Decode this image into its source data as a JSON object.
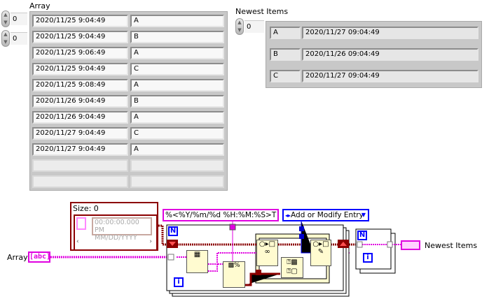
{
  "front_panel": {
    "array": {
      "label": "Array",
      "index_row": "0",
      "index_col": "0",
      "rows": [
        {
          "time": "2020/11/25 9:04:49",
          "name": "A"
        },
        {
          "time": "2020/11/25 9:04:49",
          "name": "B"
        },
        {
          "time": "2020/11/25 9:06:49",
          "name": "A"
        },
        {
          "time": "2020/11/25 9:04:49",
          "name": "C"
        },
        {
          "time": "2020/11/25 9:08:49",
          "name": "A"
        },
        {
          "time": "2020/11/26 9:04:49",
          "name": "B"
        },
        {
          "time": "2020/11/26 9:04:49",
          "name": "A"
        },
        {
          "time": "2020/11/27 9:04:49",
          "name": "C"
        },
        {
          "time": "2020/11/27 9:04:49",
          "name": "A"
        }
      ]
    },
    "newest": {
      "label": "Newest Items",
      "index": "0",
      "rows": [
        {
          "name": "A",
          "time": "2020/11/27 09:04:49"
        },
        {
          "name": "B",
          "time": "2020/11/26 09:04:49"
        },
        {
          "name": "C",
          "time": "2020/11/27 09:04:49"
        }
      ]
    }
  },
  "diagram": {
    "map_constant": {
      "size_label": "Size: 0",
      "time_placeholder": "00:00:00.000 PM",
      "date_placeholder": "MM/DD/YYYY"
    },
    "format_string": "%<%Y/%m/%d %H:%M:%S>T",
    "enum_value": "Add or Modify Entry",
    "array_terminal_label": "Array",
    "array_terminal_glyph": "[abc]",
    "newest_terminal_label": "Newest Items",
    "loop_count_label": "N",
    "loop_iter_label": "i",
    "colors": {
      "string_wire": "#e000e0",
      "map_wire": "#8b0000",
      "enum_wire": "#0000ff",
      "node_bg": "#fffbd0"
    }
  }
}
